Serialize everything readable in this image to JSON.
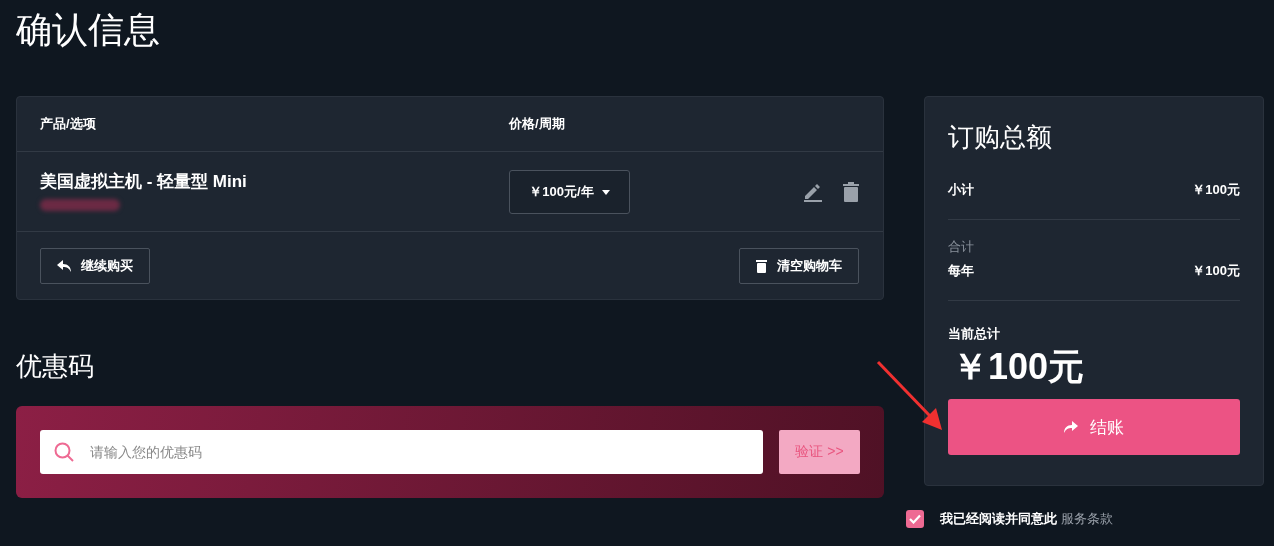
{
  "page_title": "确认信息",
  "cart": {
    "columns": [
      "产品/选项",
      "价格/周期"
    ],
    "items": [
      {
        "name": "美国虚拟主机 - 轻量型 Mini",
        "price": "￥100元/年"
      }
    ],
    "buttons": [
      "继续购买",
      "清空购物车"
    ]
  },
  "coupon": {
    "heading": "优惠码",
    "placeholder": "请输入您的优惠码",
    "button": "验证 >>"
  },
  "summary": {
    "title": "订购总额",
    "subtotal_label": "小计",
    "subtotal": "￥100元",
    "total_label": "合计",
    "period_label": "每年",
    "period_total": "￥100元",
    "current_label": "当前总计",
    "current_total": "￥100元",
    "checkout": "结账"
  },
  "agreement": {
    "checked": true,
    "text": "我已经阅读并同意此",
    "link": "服务条款"
  }
}
